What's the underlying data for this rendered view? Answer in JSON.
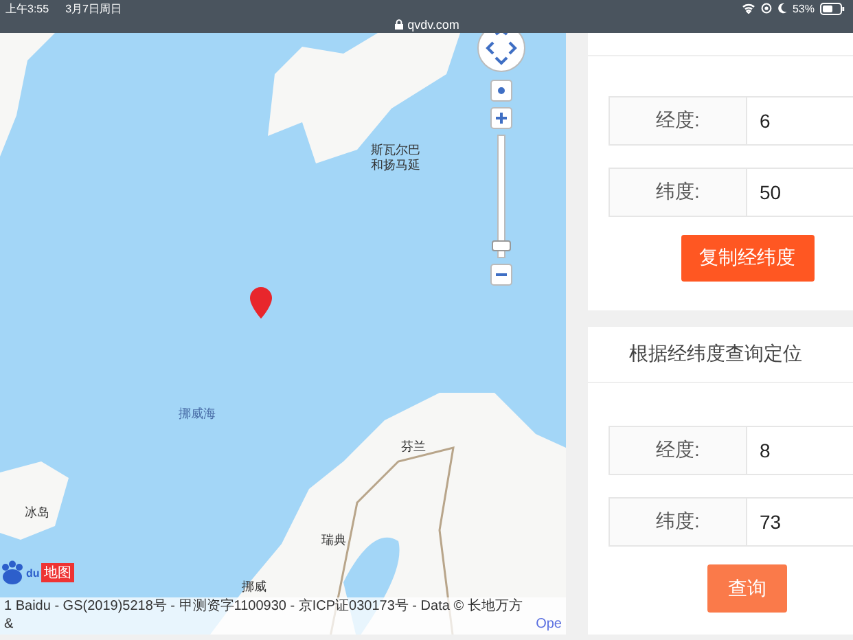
{
  "status_bar": {
    "time": "上午3:55",
    "date": "3月7日周日",
    "battery": "53%",
    "url": "qvdv.com"
  },
  "map": {
    "labels": [
      {
        "text": "斯瓦尔巴",
        "kind": "land"
      },
      {
        "text": "和扬马延",
        "kind": "land"
      },
      {
        "text": "挪威海",
        "kind": "sea"
      },
      {
        "text": "芬兰",
        "kind": "land"
      },
      {
        "text": "瑞典",
        "kind": "land"
      },
      {
        "text": "挪威",
        "kind": "land"
      },
      {
        "text": "冰岛",
        "kind": "land"
      }
    ],
    "zoom_slider": {
      "level": 0.05
    },
    "logo": {
      "mark": "du",
      "text": "地图"
    },
    "copyright": "1 Baidu - GS(2019)5218号 - 甲测资字1100930 - 京ICP证030173号 - Data © 长地万方 &",
    "copyright_link": "Ope"
  },
  "copy_panel": {
    "fields": [
      {
        "label": "经度:",
        "value": "6"
      },
      {
        "label": "纬度:",
        "value": "50"
      }
    ],
    "button": "复制经纬度"
  },
  "query_panel": {
    "title": "根据经纬度查询定位",
    "fields": [
      {
        "label": "经度:",
        "value": "8"
      },
      {
        "label": "纬度:",
        "value": "73"
      }
    ],
    "button": "查询"
  }
}
